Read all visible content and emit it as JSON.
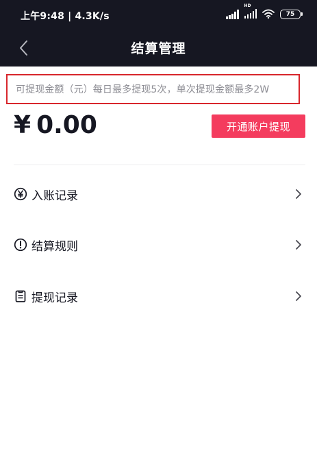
{
  "status_bar": {
    "time_speed": "上午9:48 | 4.3K/s",
    "hd_label": "HD",
    "battery": "75"
  },
  "nav": {
    "title": "结算管理"
  },
  "notice": {
    "text": "可提现金额（元）每日最多提现5次，单次提现金额最多2W"
  },
  "balance": {
    "currency": "¥",
    "amount": "0.00"
  },
  "actions": {
    "open_account_label": "开通账户提现"
  },
  "menu": {
    "items": [
      {
        "label": "入账记录",
        "icon": "yen-circle-icon"
      },
      {
        "label": "结算规则",
        "icon": "exclamation-circle-icon"
      },
      {
        "label": "提现记录",
        "icon": "clipboard-icon"
      }
    ]
  },
  "colors": {
    "header_bg": "#161722",
    "accent": "#f43c5e",
    "highlight_border": "#d8262c",
    "muted_text": "#8c8c93",
    "primary_text": "#161722"
  }
}
